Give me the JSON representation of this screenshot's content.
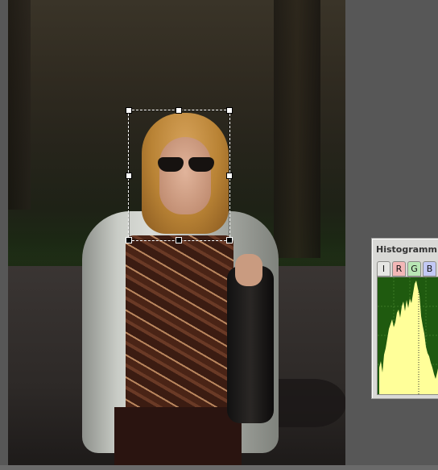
{
  "histogram_panel": {
    "title": "Histogramm",
    "tabs": [
      {
        "label": "I",
        "color": "#e6e6e3"
      },
      {
        "label": "R",
        "color": "#f3b7b7"
      },
      {
        "label": "G",
        "color": "#b9e7b5"
      },
      {
        "label": "B",
        "color": "#c3c9f5"
      }
    ],
    "plot_background": "#1f5a0f",
    "plot_fill": "#ffff99"
  },
  "canvas": {
    "selection_tool": "rectangle-selection"
  }
}
